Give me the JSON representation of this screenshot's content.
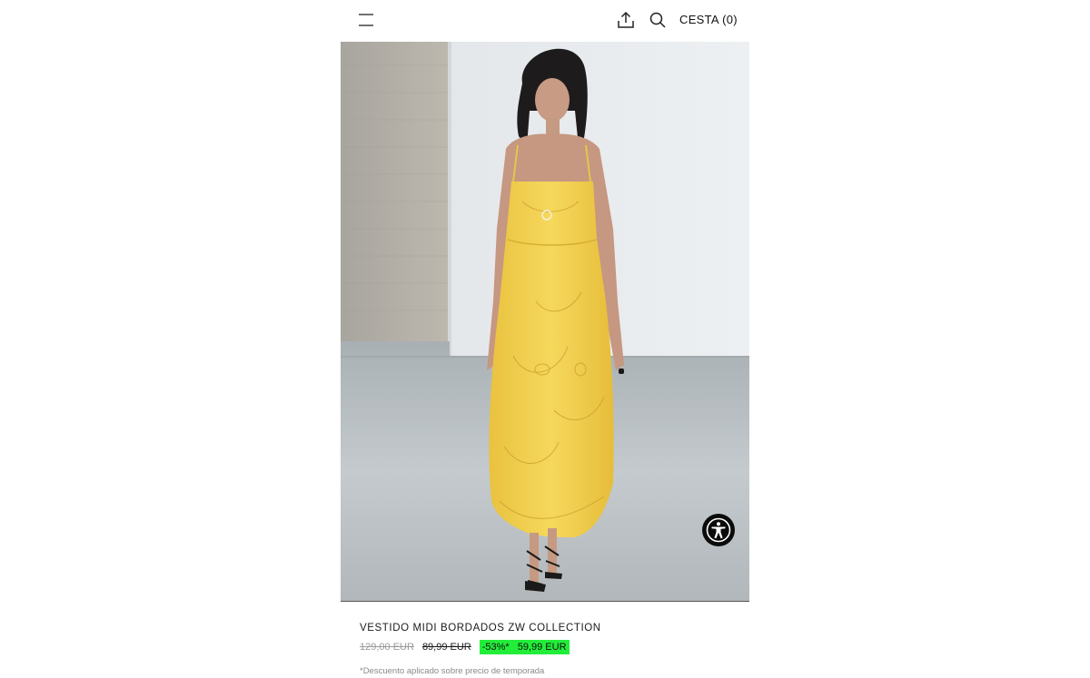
{
  "header": {
    "cart_label": "CESTA (0)"
  },
  "product": {
    "name": "VESTIDO MIDI BORDADOS ZW COLLECTION",
    "price_original": "129,00 EUR",
    "price_previous": "89,99 EUR",
    "discount": "-53%*",
    "price_current": "59,99 EUR",
    "discount_note": "*Descuento aplicado sobre precio de temporada"
  },
  "colors": {
    "discount_badge": "#22ee3a",
    "dress": "#f3d24e",
    "text": "#111111"
  },
  "icons": [
    "menu-icon",
    "share-icon",
    "search-icon",
    "accessibility-icon"
  ]
}
